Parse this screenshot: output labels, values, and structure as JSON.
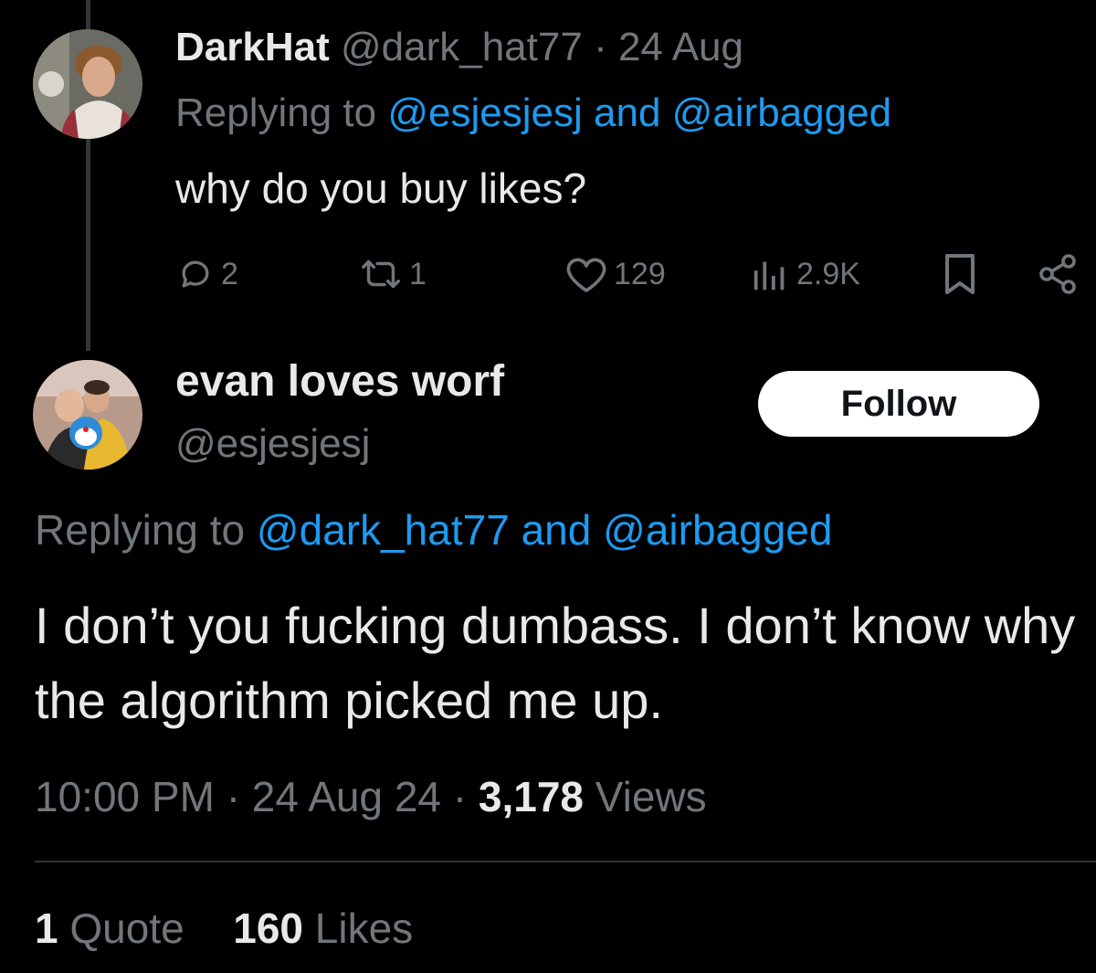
{
  "tweet1": {
    "display_name": "DarkHat",
    "handle": "@dark_hat77",
    "separator": "·",
    "date": "24 Aug",
    "replying_prefix": "Replying to",
    "replying_user1": "@esjesjesj",
    "replying_and": "and",
    "replying_user2": "@airbagged",
    "text": "why do you buy likes?",
    "actions": {
      "reply_count": "2",
      "retweet_count": "1",
      "like_count": "129",
      "views_count": "2.9K"
    },
    "icons": [
      "reply-icon",
      "retweet-icon",
      "like-icon",
      "views-icon",
      "bookmark-icon",
      "share-icon"
    ]
  },
  "tweet2": {
    "display_name": "evan loves worf",
    "handle": "@esjesjesj",
    "follow_label": "Follow",
    "replying_prefix": "Replying to",
    "replying_user1": "@dark_hat77",
    "replying_and": "and",
    "replying_user2": "@airbagged",
    "text": "I don’t you fucking dumbass. I don’t know why the algorithm picked me up.",
    "time": "10:00 PM",
    "separator": "·",
    "date": "24 Aug 24",
    "views_count": "3,178",
    "views_label": "Views",
    "quote_count": "1",
    "quote_label": "Quote",
    "likes_count": "160",
    "likes_label": "Likes"
  },
  "colors": {
    "background": "#000000",
    "text": "#e7e9ea",
    "muted": "#71767b",
    "link": "#1d9bf0",
    "follow_bg": "#ffffff"
  }
}
